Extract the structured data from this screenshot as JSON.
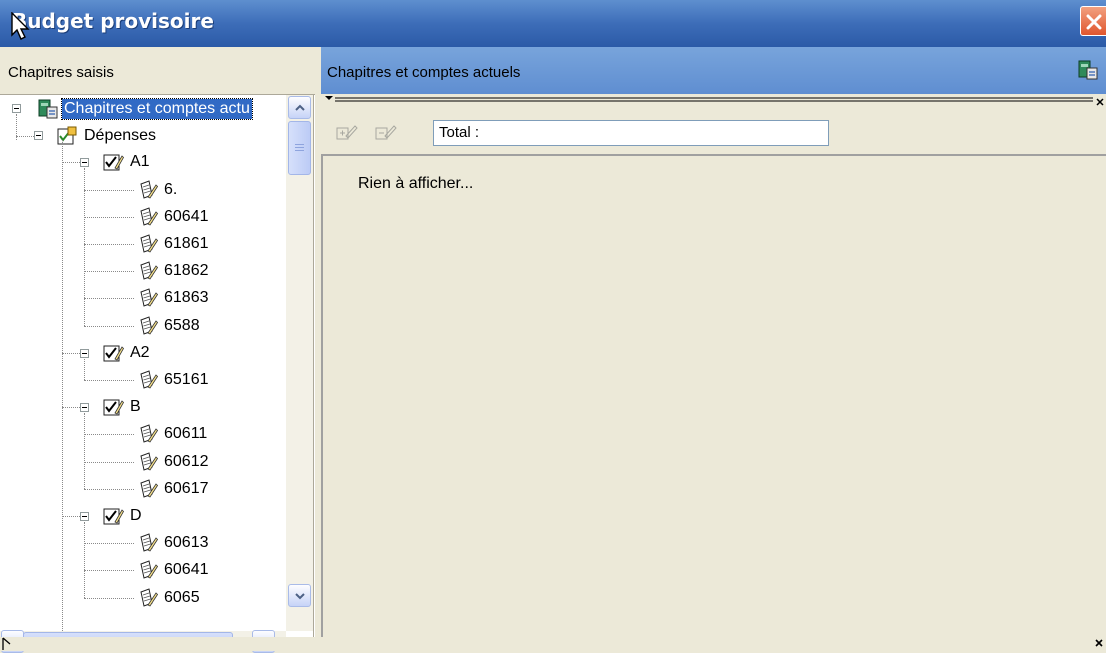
{
  "window": {
    "title": "Budget provisoire",
    "close_icon": "close-icon"
  },
  "left_panel": {
    "header": "Chapitres saisis",
    "tree": {
      "root": "Chapitres et comptes actu",
      "expenses": "Dépenses",
      "chapters": [
        {
          "label": "A1",
          "accounts": [
            "6.",
            "60641",
            "61861",
            "61862",
            "61863",
            "6588"
          ]
        },
        {
          "label": "A2",
          "accounts": [
            "65161"
          ]
        },
        {
          "label": "B",
          "accounts": [
            "60611",
            "60612",
            "60617"
          ]
        },
        {
          "label": "D",
          "accounts": [
            "60613",
            "60641",
            "6065"
          ]
        }
      ]
    }
  },
  "right_panel": {
    "header": "Chapitres et comptes actuels",
    "total_label": "Total :",
    "empty_message": "Rien à afficher..."
  },
  "colors": {
    "title_bar": "#3d6db8",
    "selection": "#316ac5",
    "header_blue": "#6b99d6",
    "close_button": "#e0562e"
  }
}
